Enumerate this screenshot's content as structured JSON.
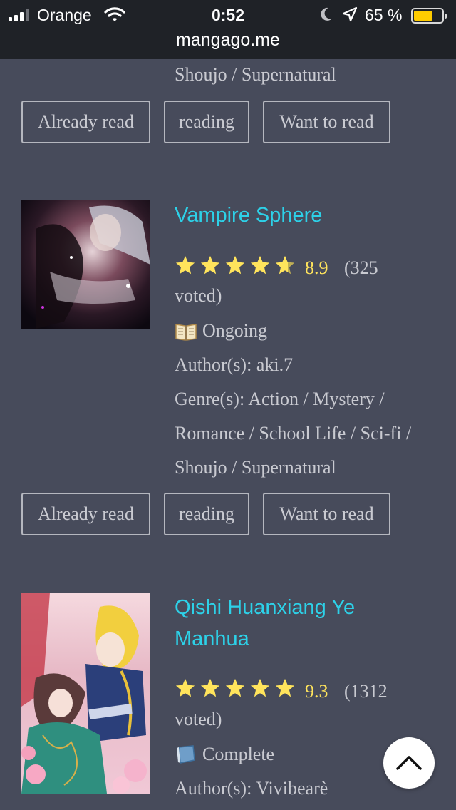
{
  "status_bar": {
    "carrier": "Orange",
    "time": "0:52",
    "battery": "65 %",
    "battery_level": 0.65,
    "url": "mangago.me"
  },
  "colors": {
    "background": "#474b5b",
    "title": "#2dd1e8",
    "score": "#ffe45c",
    "star": "#ffe45c"
  },
  "previous_entry": {
    "genre_tail": "Shoujo / Supernatural",
    "buttons": [
      "Already read",
      "reading",
      "Want to read"
    ]
  },
  "entries": [
    {
      "title": "Vampire Sphere",
      "stars": 4.5,
      "score": "8.9",
      "votes_line1": "(325",
      "votes_line2": "voted)",
      "status_icon": "open-book-icon",
      "status": "Ongoing",
      "author": "Author(s): aki.7",
      "genre_lines": [
        "Genre(s): Action / Mystery /",
        "Romance / School Life / Sci-fi /",
        "Shoujo / Supernatural"
      ],
      "buttons": [
        "Already read",
        "reading",
        "Want to read"
      ]
    },
    {
      "title_lines": [
        "Qishi Huanxiang Ye",
        "Manhua"
      ],
      "stars": 5,
      "score": "9.3",
      "votes_line1": "(1312",
      "votes_line2": "voted)",
      "status_icon": "closed-book-icon",
      "status": "Complete",
      "author": "Author(s): Vivibearè"
    }
  ]
}
